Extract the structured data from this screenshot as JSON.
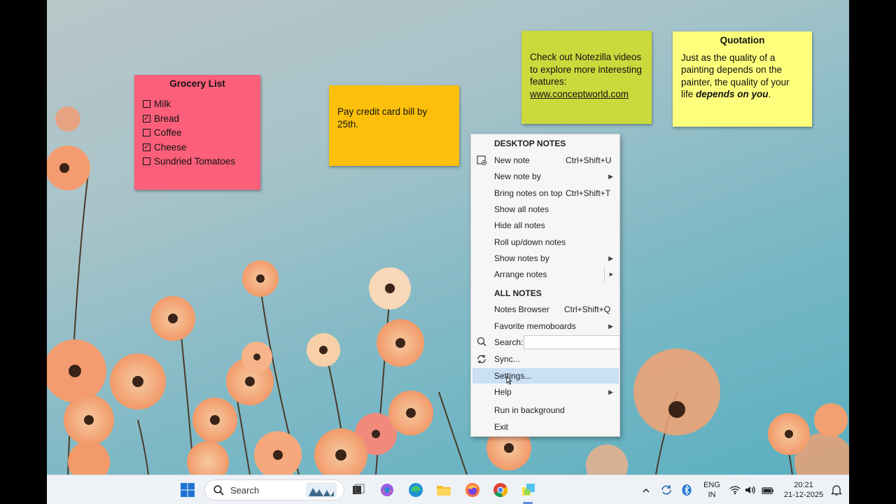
{
  "notes": {
    "grocery": {
      "title": "Grocery List",
      "items": [
        {
          "label": "Milk",
          "checked": false
        },
        {
          "label": "Bread",
          "checked": true
        },
        {
          "label": "Coffee",
          "checked": false
        },
        {
          "label": "Cheese",
          "checked": true
        },
        {
          "label": "Sundried Tomatoes",
          "checked": false
        }
      ],
      "color": "#fb5f7a"
    },
    "pay": {
      "text": "Pay credit card bill by 25th.",
      "color": "#fcc00c"
    },
    "video": {
      "text": "Check out Notezilla videos to explore more interesting features:",
      "link": "www.conceptworld.com",
      "color": "#cbd93d"
    },
    "quote": {
      "title": "Quotation",
      "text_before": "Just as the quality of a painting depends on the painter, the quality of your life ",
      "text_bold": "depends on you",
      "text_after": ".",
      "color": "#fefe7d"
    }
  },
  "menu": {
    "section_desktop": "DESKTOP NOTES",
    "new_note": "New note",
    "new_note_shortcut": "Ctrl+Shift+U",
    "new_note_by": "New note by",
    "bring_top": "Bring notes on top",
    "bring_top_shortcut": "Ctrl+Shift+T",
    "show_all": "Show all notes",
    "hide_all": "Hide all notes",
    "roll": "Roll up/down notes",
    "show_by": "Show notes by",
    "arrange": "Arrange notes",
    "section_all": "ALL NOTES",
    "browser": "Notes Browser",
    "browser_shortcut": "Ctrl+Shift+Q",
    "favorite": "Favorite memoboards",
    "search_label": "Search:",
    "sync": "Sync...",
    "settings": "Settings...",
    "help": "Help",
    "run_bg": "Run in background",
    "exit": "Exit"
  },
  "taskbar": {
    "search_label": "Search",
    "lang_line1": "ENG",
    "lang_line2": "IN",
    "time": "20:21",
    "date": "21-12-2025"
  }
}
